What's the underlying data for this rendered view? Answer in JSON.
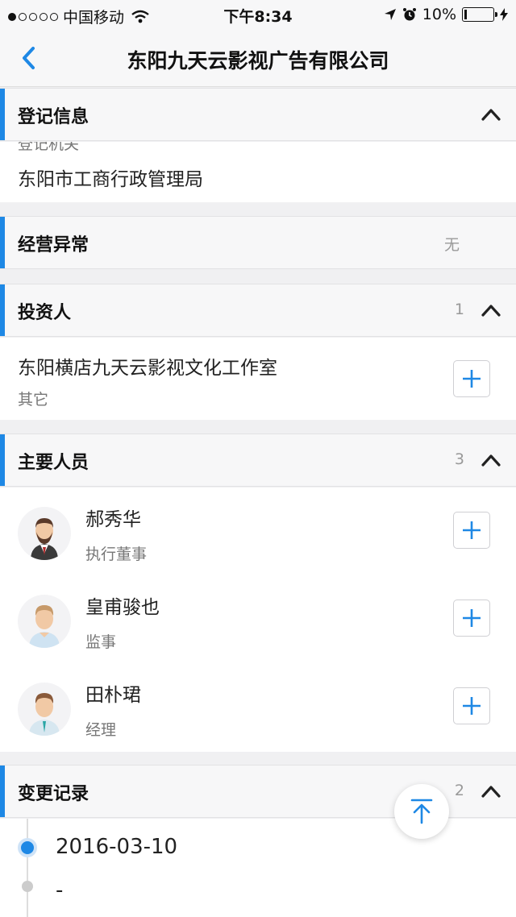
{
  "status_bar": {
    "carrier": "中国移动",
    "time": "下午8:34",
    "battery": "10%",
    "battery_level": 0.1
  },
  "nav": {
    "title": "东阳九天云影视广告有限公司"
  },
  "registration": {
    "title": "登记信息",
    "partial_label": "登记机关",
    "authority": "东阳市工商行政管理局"
  },
  "abnormal": {
    "title": "经营异常",
    "value": "无"
  },
  "investors": {
    "title": "投资人",
    "count": "1",
    "items": [
      {
        "name": "东阳横店九天云影视文化工作室",
        "type": "其它"
      }
    ]
  },
  "key_persons": {
    "title": "主要人员",
    "count": "3",
    "items": [
      {
        "name": "郝秀华",
        "role": "执行董事"
      },
      {
        "name": "皇甫骏也",
        "role": "监事"
      },
      {
        "name": "田朴珺",
        "role": "经理"
      }
    ]
  },
  "changes": {
    "title": "变更记录",
    "count": "2",
    "items": [
      {
        "date": "2016-03-10"
      },
      {
        "date": "-"
      }
    ]
  },
  "icons": {
    "back": "chevron-left-icon",
    "collapse": "chevron-up-icon",
    "add": "plus-icon",
    "scroll_top": "arrow-up-to-top-icon"
  },
  "colors": {
    "accent": "#1e88e5",
    "text": "#222222",
    "secondary": "#777777",
    "background": "#f0f0f2"
  }
}
